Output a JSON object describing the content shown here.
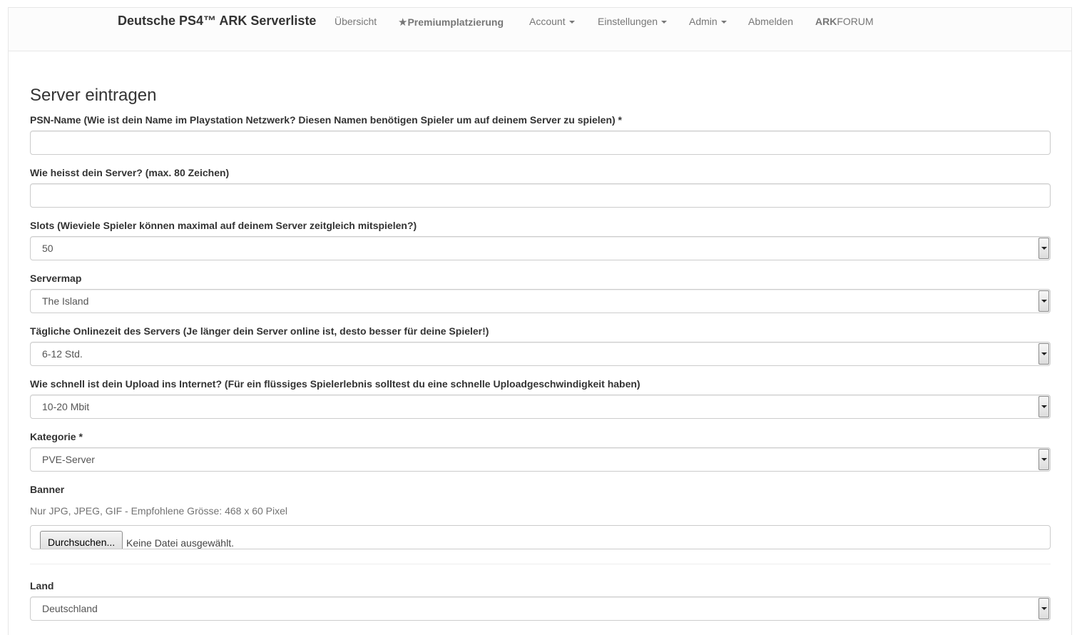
{
  "nav": {
    "brand": "Deutsche PS4™ ARK Serverliste",
    "items": [
      {
        "label": "Übersicht"
      },
      {
        "label": "Premiumplatzierung",
        "icon": "star-icon"
      },
      {
        "label": "Account",
        "dropdown": true
      },
      {
        "label": "Einstellungen",
        "dropdown": true
      },
      {
        "label": "Admin",
        "dropdown": true
      },
      {
        "label": "Abmelden"
      },
      {
        "label_bold": "ARK",
        "label_rest": "FORUM"
      }
    ]
  },
  "page": {
    "title": "Server eintragen"
  },
  "form": {
    "psn_label": "PSN-Name (Wie ist dein Name im Playstation Netzwerk? Diesen Namen benötigen Spieler um auf deinem Server zu spielen) *",
    "psn_value": "",
    "servername_label": "Wie heisst dein Server? (max. 80 Zeichen)",
    "servername_value": "",
    "slots_label": "Slots (Wieviele Spieler können maximal auf deinem Server zeitgleich mitspielen?)",
    "slots_value": "50",
    "map_label": "Servermap",
    "map_value": "The Island",
    "online_label": "Tägliche Onlinezeit des Servers (Je länger dein Server online ist, desto besser für deine Spieler!)",
    "online_value": "6-12 Std.",
    "upload_label": "Wie schnell ist dein Upload ins Internet? (Für ein flüssiges Spielerlebnis solltest du eine schnelle Uploadgeschwindigkeit haben)",
    "upload_value": "10-20 Mbit",
    "category_label": "Kategorie *",
    "category_value": "PVE-Server",
    "banner_label": "Banner",
    "banner_help": "Nur JPG, JPEG, GIF - Empfohlene Grösse: 468 x 60 Pixel",
    "banner_button": "Durchsuchen...",
    "banner_status": "Keine Datei ausgewählt.",
    "country_label": "Land",
    "country_value": "Deutschland"
  }
}
